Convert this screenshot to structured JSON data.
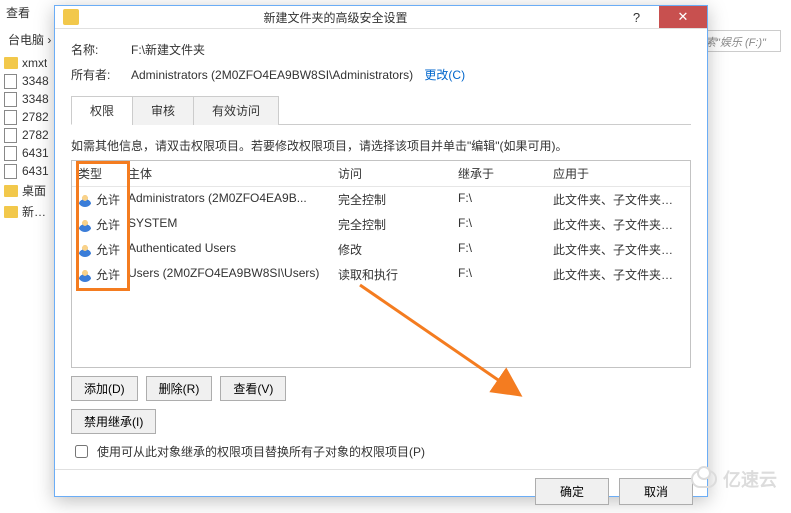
{
  "back": {
    "toolbar_label": "查看",
    "breadcrumb": "台电脑 › 新",
    "search_placeholder": "搜索\"娱乐 (F:)\"",
    "sidebar": [
      {
        "icon": "folder",
        "label": "xmxt"
      },
      {
        "icon": "page",
        "label": "3348"
      },
      {
        "icon": "page",
        "label": "3348"
      },
      {
        "icon": "page",
        "label": "2782"
      },
      {
        "icon": "page",
        "label": "2782"
      },
      {
        "icon": "page",
        "label": "6431"
      },
      {
        "icon": "page",
        "label": "6431"
      },
      {
        "icon": "folder",
        "label": "桌面"
      },
      {
        "icon": "folder",
        "label": "新建文"
      }
    ]
  },
  "dialog": {
    "title": "新建文件夹的高级安全设置",
    "name_label": "名称:",
    "name_value": "F:\\新建文件夹",
    "owner_label": "所有者:",
    "owner_value": "Administrators (2M0ZFO4EA9BW8SI\\Administrators)",
    "change_link": "更改(C)",
    "tabs": {
      "perm": "权限",
      "audit": "审核",
      "effective": "有效访问"
    },
    "info_text": "如需其他信息，请双击权限项目。若要修改权限项目，请选择该项目并单击\"编辑\"(如果可用)。",
    "table": {
      "headers": {
        "type": "类型",
        "principal": "主体",
        "access": "访问",
        "inherited": "继承于",
        "applies": "应用于"
      },
      "rows": [
        {
          "type": "允许",
          "principal": "Administrators (2M0ZFO4EA9B...",
          "access": "完全控制",
          "inherited": "F:\\",
          "applies": "此文件夹、子文件夹和文件"
        },
        {
          "type": "允许",
          "principal": "SYSTEM",
          "access": "完全控制",
          "inherited": "F:\\",
          "applies": "此文件夹、子文件夹和文件"
        },
        {
          "type": "允许",
          "principal": "Authenticated Users",
          "access": "修改",
          "inherited": "F:\\",
          "applies": "此文件夹、子文件夹和文件"
        },
        {
          "type": "允许",
          "principal": "Users (2M0ZFO4EA9BW8SI\\Users)",
          "access": "读取和执行",
          "inherited": "F:\\",
          "applies": "此文件夹、子文件夹和文件"
        }
      ]
    },
    "buttons": {
      "add": "添加(D)",
      "remove": "删除(R)",
      "view": "查看(V)",
      "disable_inherit": "禁用继承(I)"
    },
    "replace_checkbox": "使用可从此对象继承的权限项目替换所有子对象的权限项目(P)",
    "footer": {
      "ok": "确定",
      "cancel": "取消"
    },
    "winbtn": {
      "help": "?",
      "close": "✕"
    }
  },
  "watermark": "亿速云"
}
